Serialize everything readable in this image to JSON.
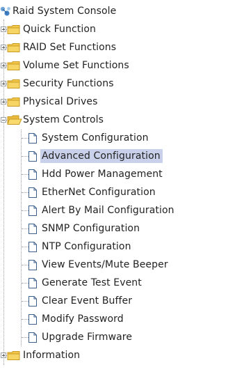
{
  "tree": {
    "root": {
      "label": "Raid System Console",
      "icon": "network-icon"
    },
    "groups": [
      {
        "label": "Quick Function",
        "state": "collapsed",
        "icon": "folder-closed-icon"
      },
      {
        "label": "RAID Set Functions",
        "state": "collapsed",
        "icon": "folder-closed-icon"
      },
      {
        "label": "Volume Set Functions",
        "state": "collapsed",
        "icon": "folder-closed-icon"
      },
      {
        "label": "Security Functions",
        "state": "collapsed",
        "icon": "folder-closed-icon"
      },
      {
        "label": "Physical Drives",
        "state": "collapsed",
        "icon": "folder-closed-icon"
      },
      {
        "label": "System Controls",
        "state": "expanded",
        "icon": "folder-open-icon"
      },
      {
        "label": "Information",
        "state": "collapsed",
        "icon": "folder-closed-icon"
      }
    ],
    "system_controls_items": [
      {
        "label": "System Configuration"
      },
      {
        "label": "Advanced Configuration",
        "selected": true
      },
      {
        "label": "Hdd Power Management"
      },
      {
        "label": "EtherNet Configuration"
      },
      {
        "label": "Alert By Mail Configuration"
      },
      {
        "label": "SNMP Configuration"
      },
      {
        "label": "NTP Configuration"
      },
      {
        "label": "View Events/Mute Beeper"
      },
      {
        "label": "Generate Test Event"
      },
      {
        "label": "Clear Event Buffer"
      },
      {
        "label": "Modify Password"
      },
      {
        "label": "Upgrade Firmware"
      }
    ],
    "colors": {
      "folder": "#f2c84a",
      "selection": "#c9d0ea",
      "lines": "#9aa0a8",
      "text": "#222222"
    }
  }
}
